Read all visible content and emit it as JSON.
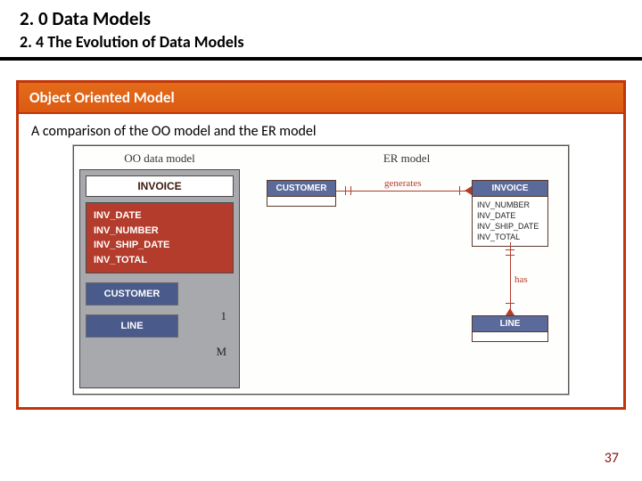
{
  "title": "2. 0 Data Models",
  "subtitle": "2. 4 The Evolution of Data Models",
  "card_header": "Object Oriented Model",
  "comparison_text": "A comparison of the OO model and the ER model",
  "oo": {
    "label": "OO data model",
    "header": "INVOICE",
    "attrs": [
      "INV_DATE",
      "INV_NUMBER",
      "INV_SHIP_DATE",
      "INV_TOTAL"
    ],
    "child1": "CUSTOMER",
    "child2": "LINE",
    "mult1": "1",
    "multM": "M"
  },
  "er": {
    "label": "ER model",
    "customer": {
      "title": "CUSTOMER"
    },
    "invoice": {
      "title": "INVOICE",
      "attrs": [
        "INV_NUMBER",
        "INV_DATE",
        "INV_SHIP_DATE",
        "INV_TOTAL"
      ]
    },
    "line": {
      "title": "LINE"
    },
    "rel1": "generates",
    "rel2": "has"
  },
  "page_number": "37"
}
